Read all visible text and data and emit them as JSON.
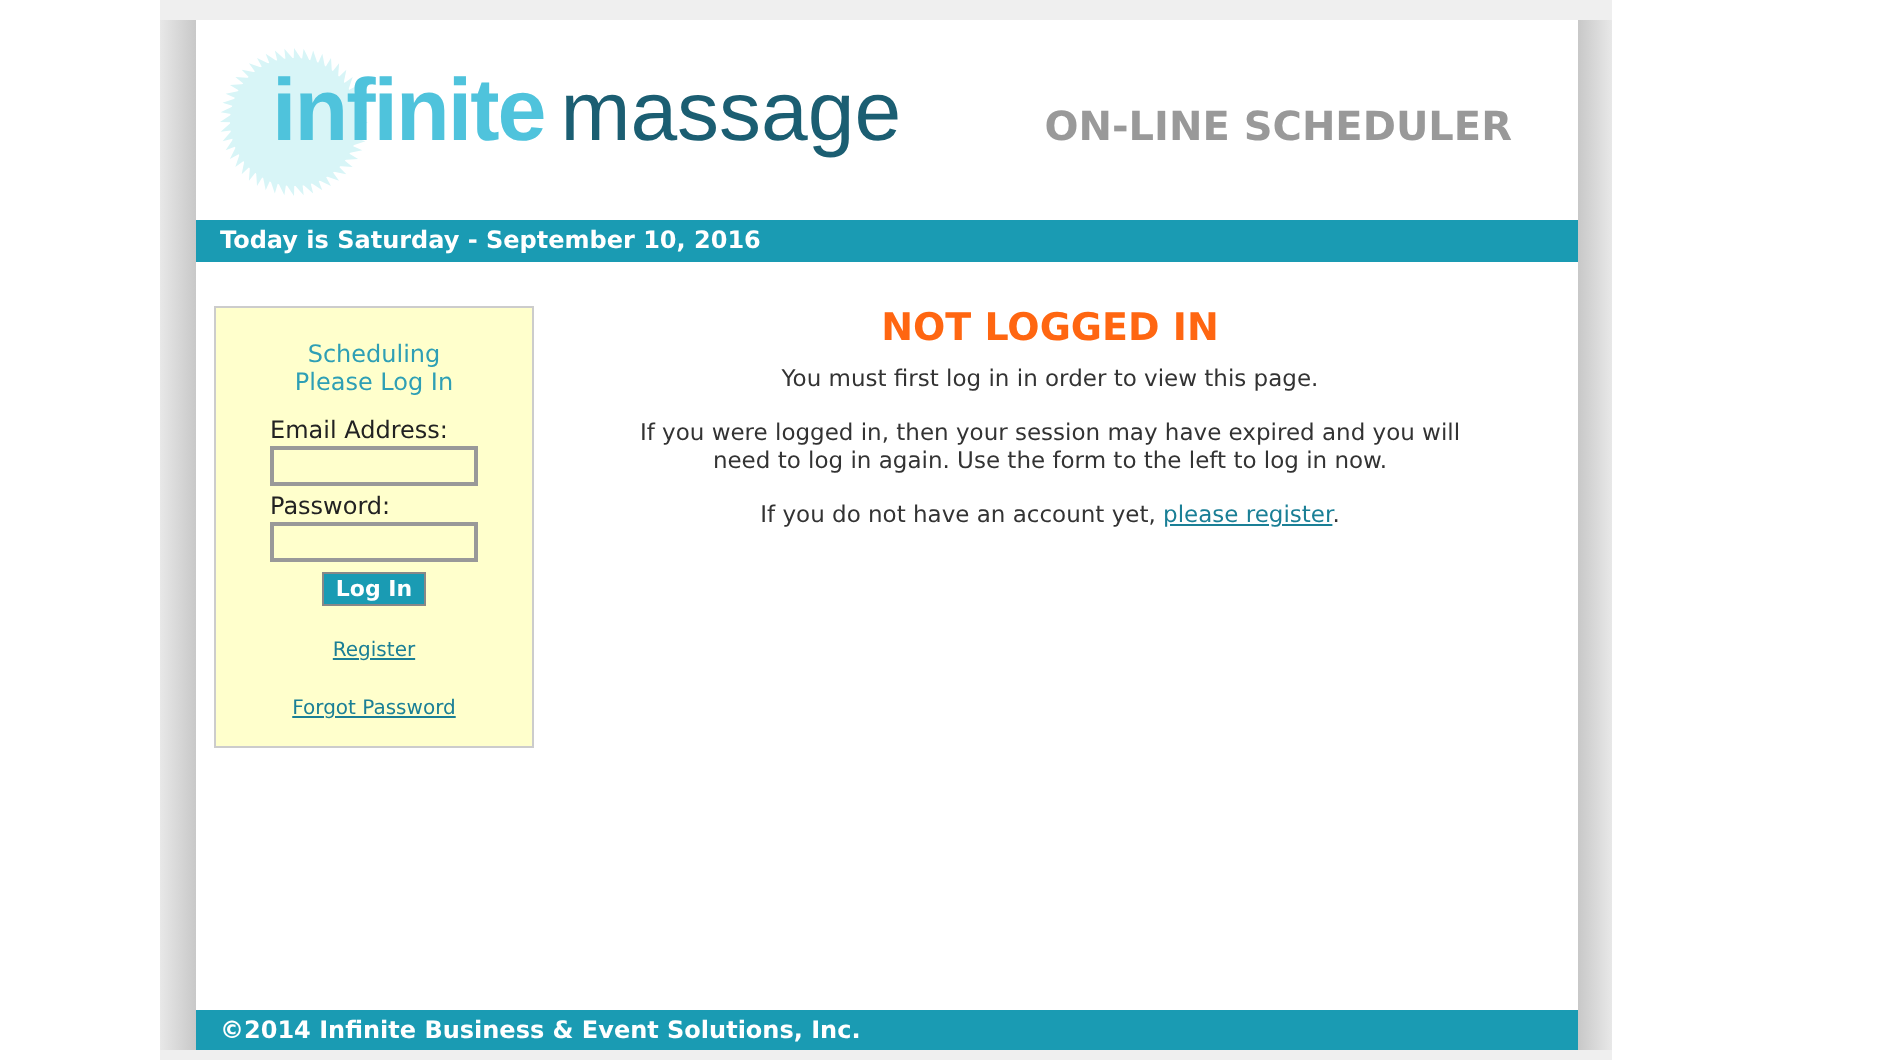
{
  "logo": {
    "word_1": "infinite",
    "word_2": "massage"
  },
  "header_title": "ON-LINE SCHEDULER",
  "date_bar": "Today is Saturday - September 10, 2016",
  "login_panel": {
    "title_lines": [
      "Scheduling",
      "Please Log In"
    ],
    "fields": [
      {
        "label": "Email Address:"
      },
      {
        "label": "Password:"
      }
    ],
    "button": "Log In",
    "links": [
      "Register",
      "Forgot Password"
    ]
  },
  "message": {
    "title": "NOT LOGGED IN",
    "paragraphs": [
      "You must first log in in order to view this page.",
      "If you were logged in, then your session may have expired and you will need to log in again. Use the form to the left to log in now."
    ],
    "register_prefix": "If you do not have an account yet,",
    "register_link": "please register",
    "register_suffix": "."
  },
  "footer": "©2014 Infinite Business & Event Solutions, Inc."
}
